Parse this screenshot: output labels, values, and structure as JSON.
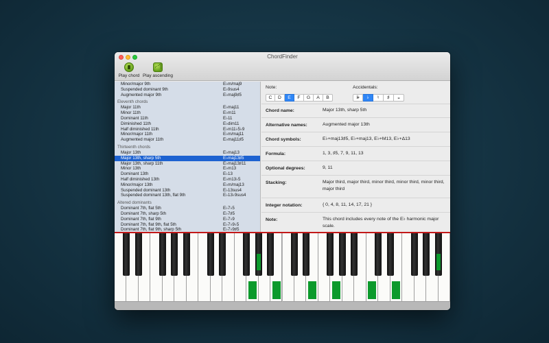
{
  "window": {
    "title": "ChordFinder"
  },
  "toolbar": {
    "play_chord": "Play chord",
    "play_ascending": "Play ascending"
  },
  "chord_list": {
    "groups": [
      {
        "name": null,
        "rows": [
          {
            "name": "Minor/major 9th",
            "symbol": "E♭m/maj9"
          },
          {
            "name": "Suspended dominant 9th",
            "symbol": "E♭9sus4"
          },
          {
            "name": "Augmented major 9th",
            "symbol": "E♭maj9♯5"
          }
        ]
      },
      {
        "name": "Eleventh chords",
        "rows": [
          {
            "name": "Major 11th",
            "symbol": "E♭maj11"
          },
          {
            "name": "Minor 11th",
            "symbol": "E♭m11"
          },
          {
            "name": "Dominant 11th",
            "symbol": "E♭11"
          },
          {
            "name": "Diminished 11th",
            "symbol": "E♭dim11"
          },
          {
            "name": "Half diminished 11th",
            "symbol": "E♭m11♭5♭9"
          },
          {
            "name": "Minor/major 11th",
            "symbol": "E♭m/maj11"
          },
          {
            "name": "Augmented major 11th",
            "symbol": "E♭maj11♯5"
          }
        ]
      },
      {
        "name": "Thirteenth chords",
        "rows": [
          {
            "name": "Major 13th",
            "symbol": "E♭maj13"
          },
          {
            "name": "Major 13th, sharp 5th",
            "symbol": "E♭maj13♯5",
            "selected": true
          },
          {
            "name": "Major 13th, sharp 11th",
            "symbol": "E♭maj13♯11"
          },
          {
            "name": "Minor 13th",
            "symbol": "E♭m13"
          },
          {
            "name": "Dominant 13th",
            "symbol": "E♭13"
          },
          {
            "name": "Half diminished 13th",
            "symbol": "E♭m13♭5"
          },
          {
            "name": "Minor/major 13th",
            "symbol": "E♭m/maj13"
          },
          {
            "name": "Suspended dominant 13th",
            "symbol": "E♭13sus4"
          },
          {
            "name": "Suspended dominant 13th, flat 9th",
            "symbol": "E♭13♭9sus4"
          }
        ]
      },
      {
        "name": "Altered dominants",
        "rows": [
          {
            "name": "Dominant 7th, flat 5th",
            "symbol": "E♭7♭5"
          },
          {
            "name": "Dominant 7th, sharp 5th",
            "symbol": "E♭7♯5"
          },
          {
            "name": "Dominant 7th, flat 9th",
            "symbol": "E♭7♭9"
          },
          {
            "name": "Dominant 7th, flat 9th, flat 5th",
            "symbol": "E♭7♭9♭5"
          },
          {
            "name": "Dominant 7th, flat 9th, sharp 5th",
            "symbol": "E♭7♭9♯5"
          }
        ]
      }
    ]
  },
  "note_selector": {
    "label": "Note:",
    "options": [
      "C",
      "D",
      "E",
      "F",
      "G",
      "A",
      "B"
    ],
    "selected": "E"
  },
  "accidentals": {
    "label": "Accidentals:",
    "options": [
      "𝄫",
      "♭",
      "♮",
      "♯",
      "𝄪"
    ],
    "selected": "♭"
  },
  "details": {
    "chord_name": {
      "label": "Chord name:",
      "value": "Major 13th, sharp 5th"
    },
    "alt_names": {
      "label": "Alternative names:",
      "value": "Augmented major 13th"
    },
    "symbols": {
      "label": "Chord symbols:",
      "value": "E♭+maj13♯5, E♭+maj13, E♭+M13, E♭+Δ13"
    },
    "formula": {
      "label": "Formula:",
      "value": "1, 3, ♯5, 7, 9, 11, 13"
    },
    "optional": {
      "label": "Optional degrees:",
      "value": "9, 11"
    },
    "stacking": {
      "label": "Stacking:",
      "value": "Major third, major third, minor third, minor third, minor third, major third"
    },
    "integer": {
      "label": "Integer notation:",
      "value": "{ 0, 4, 8, 11, 14, 17, 21 }"
    },
    "note": {
      "label": "Note:",
      "value": "This chord includes every note of the E♭ harmonic major scale."
    }
  },
  "piano": {
    "white_key_count": 28,
    "black_pattern": [
      1,
      1,
      0,
      1,
      1,
      1,
      0
    ],
    "highlighted_white_keys": [
      11,
      13,
      16,
      18,
      21,
      23
    ],
    "highlighted_black_keys": [
      8,
      19
    ],
    "highlight_color": "#0c9a2c"
  },
  "colors": {
    "selection": "#1d62d1",
    "segment_selected": "#2f86f6",
    "piano_top_line": "#c21818"
  }
}
